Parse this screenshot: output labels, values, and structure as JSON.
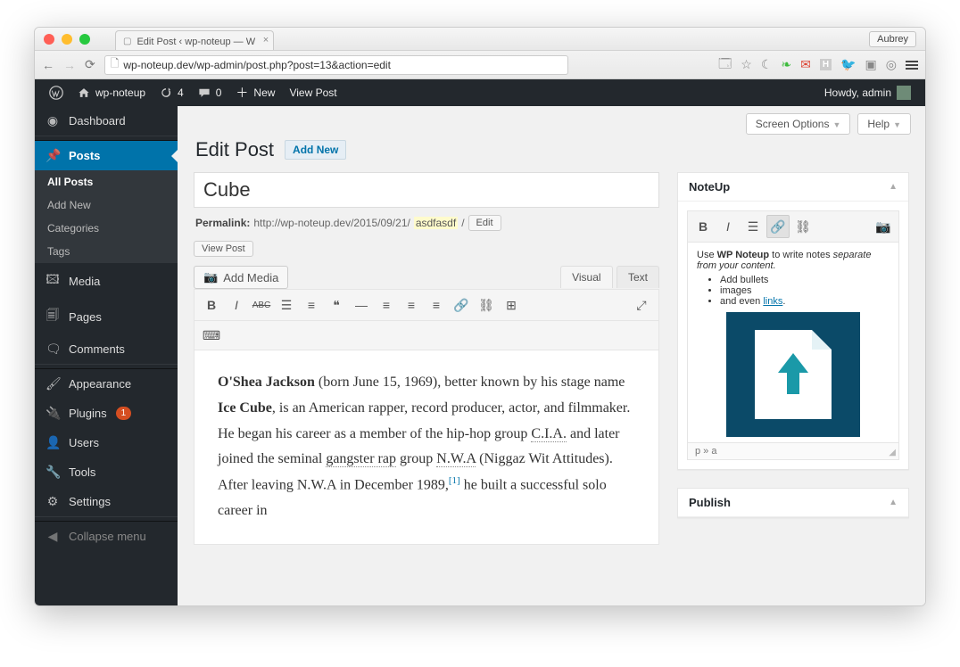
{
  "browser": {
    "tab_title": "Edit Post ‹ wp-noteup — W",
    "user_chip": "Aubrey",
    "url": "wp-noteup.dev/wp-admin/post.php?post=13&action=edit"
  },
  "adminbar": {
    "site_name": "wp-noteup",
    "updates": "4",
    "comments": "0",
    "new_label": "New",
    "view_post": "View Post",
    "greeting": "Howdy, admin"
  },
  "sidebar": {
    "dashboard": "Dashboard",
    "posts": "Posts",
    "posts_sub": {
      "all": "All Posts",
      "add": "Add New",
      "cat": "Categories",
      "tags": "Tags"
    },
    "media": "Media",
    "pages": "Pages",
    "comments": "Comments",
    "appearance": "Appearance",
    "plugins": "Plugins",
    "plugins_badge": "1",
    "users": "Users",
    "tools": "Tools",
    "settings": "Settings",
    "collapse": "Collapse menu"
  },
  "topbuttons": {
    "screen": "Screen Options",
    "help": "Help"
  },
  "page": {
    "heading": "Edit Post",
    "addnew": "Add New",
    "title_value": "Cube",
    "permalink_label": "Permalink:",
    "permalink_base": "http://wp-noteup.dev/2015/09/21/",
    "permalink_slug": "asdfasdf",
    "permalink_trail": "/",
    "edit_btn": "Edit",
    "viewpost_btn": "View Post"
  },
  "editor": {
    "addmedia": "Add Media",
    "tabs": {
      "visual": "Visual",
      "text": "Text"
    },
    "body": {
      "b1": "O'Shea Jackson",
      "t1": " (born June 15, 1969), better known by his stage name ",
      "b2": "Ice Cube",
      "t2": ", is an American rapper, record producer, actor, and filmmaker. He began his career as a member of the hip-hop group ",
      "u1": "C.I.A.",
      "t3": " and later joined the seminal ",
      "u2": "gangster rap",
      "t4": " group ",
      "u3": "N.W.A",
      "t5": " (Niggaz Wit Attitudes). After leaving N.W.A in December 1989,",
      "sup": "[1]",
      "t6": " he built a successful solo career in"
    }
  },
  "noteup": {
    "title": "NoteUp",
    "intro_pre": "Use ",
    "intro_b": "WP Noteup",
    "intro_mid": " to write notes ",
    "intro_i": "separate from your content.",
    "bullets": {
      "b1": "Add bullets",
      "b2": "images",
      "b3_pre": "and even ",
      "b3_link": "links",
      "b3_post": "."
    },
    "status": "p » a"
  },
  "publish": {
    "title": "Publish"
  }
}
